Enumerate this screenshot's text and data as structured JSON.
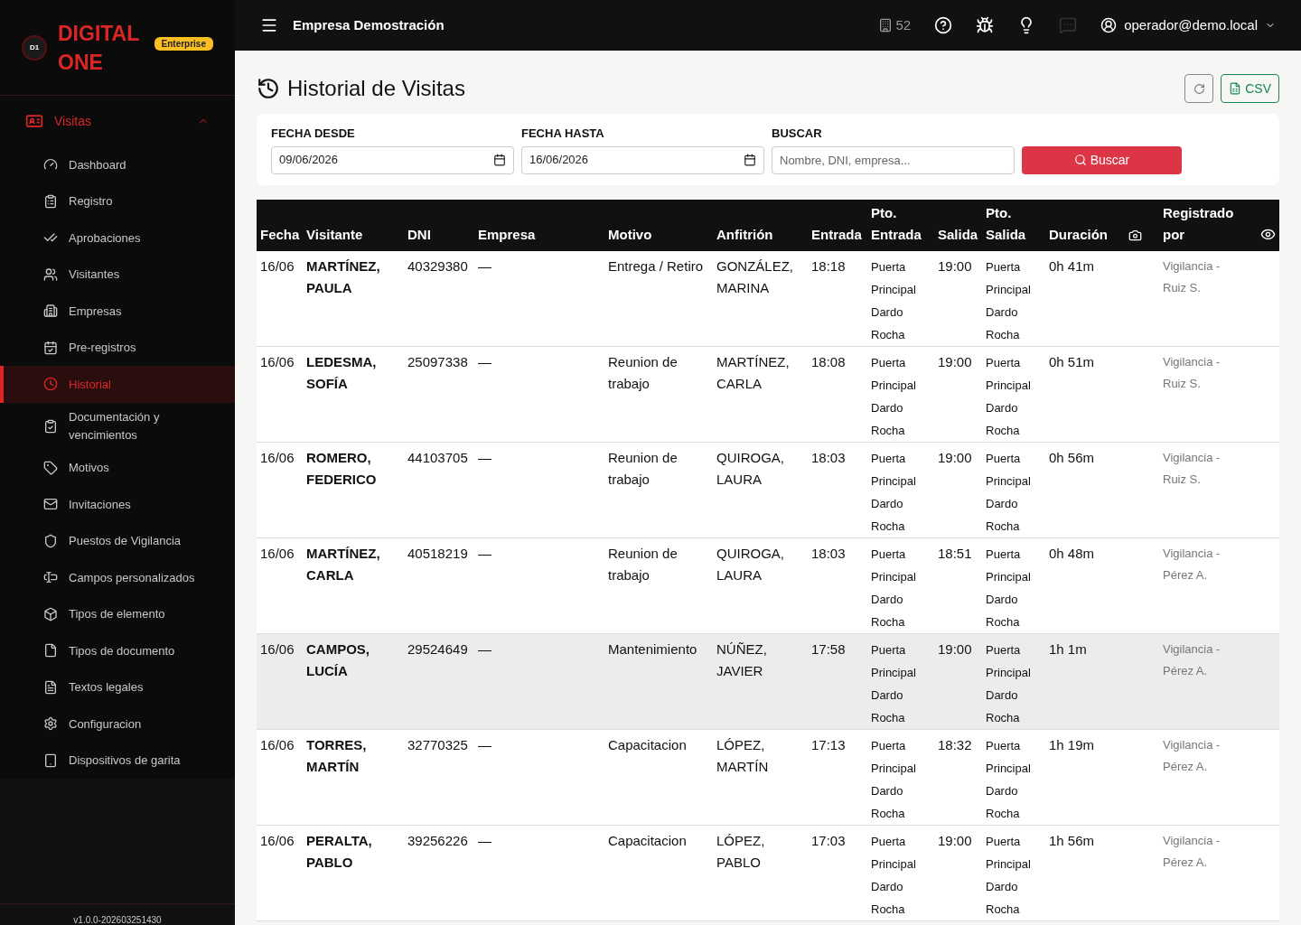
{
  "brand": {
    "logo_mark": "D1",
    "name_line1": "DIGITAL",
    "name_line2": "ONE",
    "plan_badge": "Enterprise"
  },
  "sidebar": {
    "section": {
      "label": "Visitas",
      "expanded": true
    },
    "items": [
      {
        "label": "Dashboard",
        "selected": false
      },
      {
        "label": "Registro",
        "selected": false
      },
      {
        "label": "Aprobaciones",
        "selected": false
      },
      {
        "label": "Visitantes",
        "selected": false
      },
      {
        "label": "Empresas",
        "selected": false
      },
      {
        "label": "Pre-registros",
        "selected": false
      },
      {
        "label": "Historial",
        "selected": true
      },
      {
        "label": "Documentación y vencimientos",
        "selected": false
      },
      {
        "label": "Motivos",
        "selected": false
      },
      {
        "label": "Invitaciones",
        "selected": false
      },
      {
        "label": "Puestos de Vigilancia",
        "selected": false
      },
      {
        "label": "Campos personalizados",
        "selected": false
      },
      {
        "label": "Tipos de elemento",
        "selected": false
      },
      {
        "label": "Tipos de documento",
        "selected": false
      },
      {
        "label": "Textos legales",
        "selected": false
      },
      {
        "label": "Configuracion",
        "selected": false
      },
      {
        "label": "Dispositivos de garita",
        "selected": false
      }
    ],
    "version": "v1.0.0-202603251430"
  },
  "topbar": {
    "company": "Empresa Demostración",
    "building_count": "52",
    "user": "operador@demo.local"
  },
  "page": {
    "title": "Historial de Visitas",
    "export_button": "CSV"
  },
  "filters": {
    "date_from": {
      "label": "FECHA DESDE",
      "value": "09/06/2026"
    },
    "date_to": {
      "label": "FECHA HASTA",
      "value": "16/06/2026"
    },
    "search": {
      "label": "BUSCAR",
      "placeholder": "Nombre, DNI, empresa..."
    },
    "search_button": "Buscar"
  },
  "table": {
    "columns": [
      {
        "kind": "text",
        "line2": "Fecha"
      },
      {
        "kind": "text",
        "line2": "Visitante"
      },
      {
        "kind": "text",
        "line2": "DNI"
      },
      {
        "kind": "text",
        "line2": "Empresa"
      },
      {
        "kind": "text",
        "line2": "Motivo"
      },
      {
        "kind": "text",
        "line2": "Anfitrión"
      },
      {
        "kind": "text",
        "line2": "Entrada"
      },
      {
        "kind": "text",
        "line1": "Pto.",
        "line2": "Entrada"
      },
      {
        "kind": "text",
        "line2": "Salida"
      },
      {
        "kind": "text",
        "line1": "Pto.",
        "line2": "Salida"
      },
      {
        "kind": "text",
        "line2": "Duración"
      },
      {
        "kind": "icon"
      },
      {
        "kind": "text",
        "line1": "Registrado",
        "line2": "por"
      }
    ],
    "rows": [
      {
        "date": "16/06",
        "visitor": "MARTÍNEZ, PAULA",
        "dni": "40329380",
        "company": "—",
        "reason": "Entrega / Retiro",
        "host": "GONZÁLEZ, MARINA",
        "in": "18:18",
        "in_post": "Puerta Principal Dardo Rocha",
        "out": "19:00",
        "out_post": "Puerta Principal Dardo Rocha",
        "duration": "0h 41m",
        "registered_by": "Vigilancia - Ruiz S.",
        "highlighted": false
      },
      {
        "date": "16/06",
        "visitor": "LEDESMA, SOFÍA",
        "dni": "25097338",
        "company": "—",
        "reason": "Reunion de trabajo",
        "host": "MARTÍNEZ, CARLA",
        "in": "18:08",
        "in_post": "Puerta Principal Dardo Rocha",
        "out": "19:00",
        "out_post": "Puerta Principal Dardo Rocha",
        "duration": "0h 51m",
        "registered_by": "Vigilancia - Ruiz S.",
        "highlighted": false
      },
      {
        "date": "16/06",
        "visitor": "ROMERO, FEDERICO",
        "dni": "44103705",
        "company": "—",
        "reason": "Reunion de trabajo",
        "host": "QUIROGA, LAURA",
        "in": "18:03",
        "in_post": "Puerta Principal Dardo Rocha",
        "out": "19:00",
        "out_post": "Puerta Principal Dardo Rocha",
        "duration": "0h 56m",
        "registered_by": "Vigilancia - Ruiz S.",
        "highlighted": false
      },
      {
        "date": "16/06",
        "visitor": "MARTÍNEZ, CARLA",
        "dni": "40518219",
        "company": "—",
        "reason": "Reunion de trabajo",
        "host": "QUIROGA, LAURA",
        "in": "18:03",
        "in_post": "Puerta Principal Dardo Rocha",
        "out": "18:51",
        "out_post": "Puerta Principal Dardo Rocha",
        "duration": "0h 48m",
        "registered_by": "Vigilancia - Pérez A.",
        "highlighted": false
      },
      {
        "date": "16/06",
        "visitor": "CAMPOS, LUCÍA",
        "dni": "29524649",
        "company": "—",
        "reason": "Mantenimiento",
        "host": "NÚÑEZ, JAVIER",
        "in": "17:58",
        "in_post": "Puerta Principal Dardo Rocha",
        "out": "19:00",
        "out_post": "Puerta Principal Dardo Rocha",
        "duration": "1h 1m",
        "registered_by": "Vigilancia - Pérez A.",
        "highlighted": true
      },
      {
        "date": "16/06",
        "visitor": "TORRES, MARTÍN",
        "dni": "32770325",
        "company": "—",
        "reason": "Capacitacion",
        "host": "LÓPEZ, MARTÍN",
        "in": "17:13",
        "in_post": "Puerta Principal Dardo Rocha",
        "out": "18:32",
        "out_post": "Puerta Principal Dardo Rocha",
        "duration": "1h 19m",
        "registered_by": "Vigilancia - Pérez A.",
        "highlighted": false
      },
      {
        "date": "16/06",
        "visitor": "PERALTA, PABLO",
        "dni": "39256226",
        "company": "—",
        "reason": "Capacitacion",
        "host": "LÓPEZ, PABLO",
        "in": "17:03",
        "in_post": "Puerta Principal Dardo Rocha",
        "out": "19:00",
        "out_post": "Puerta Principal Dardo Rocha",
        "duration": "1h 56m",
        "registered_by": "Vigilancia - Pérez A.",
        "highlighted": false
      }
    ]
  }
}
